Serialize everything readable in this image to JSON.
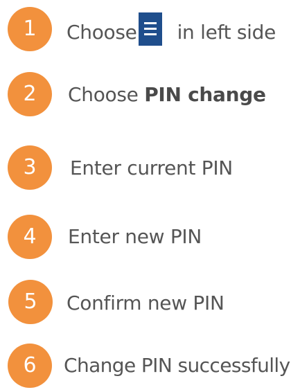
{
  "theme": {
    "accent": "#f2913d",
    "icon_bg": "#1f4e8c",
    "text": "#555555"
  },
  "steps": [
    {
      "number": "1",
      "text_before": "Choose",
      "icon": "hamburger-menu-icon",
      "text_after": "in left side"
    },
    {
      "number": "2",
      "text": "Choose",
      "emphasis": "PIN change"
    },
    {
      "number": "3",
      "text": "Enter current PIN"
    },
    {
      "number": "4",
      "text": "Enter new PIN"
    },
    {
      "number": "5",
      "text": "Confirm new PIN"
    },
    {
      "number": "6",
      "text": "Change PIN successfully"
    }
  ]
}
